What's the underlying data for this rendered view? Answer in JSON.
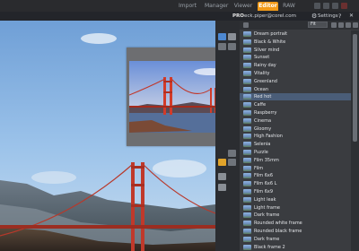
{
  "header": {
    "tabs": [
      {
        "label": "Import",
        "active": false
      },
      {
        "label": "Manager",
        "active": false
      },
      {
        "label": "Viewer",
        "active": false
      },
      {
        "label": "Editor",
        "active": true
      },
      {
        "label": "RAW",
        "active": false
      }
    ],
    "accent_color": "#f29a18"
  },
  "subheader": {
    "pro_label": "PRO",
    "email": "eck.piper@corel.com",
    "settings_label": "Settings",
    "help_label": "?",
    "icons": [
      "gear-icon",
      "close-icon"
    ]
  },
  "panel": {
    "fit_label": "Fit",
    "fit_value": "Fit",
    "presets": [
      {
        "label": "Dream portrait",
        "selected": false
      },
      {
        "label": "Black & White",
        "selected": false
      },
      {
        "label": "Silver mind",
        "selected": false
      },
      {
        "label": "Sunset",
        "selected": false
      },
      {
        "label": "Rainy day",
        "selected": false
      },
      {
        "label": "Vitality",
        "selected": false
      },
      {
        "label": "Greenland",
        "selected": false
      },
      {
        "label": "Ocean",
        "selected": false
      },
      {
        "label": "Red hot",
        "selected": true
      },
      {
        "label": "Caffe",
        "selected": false
      },
      {
        "label": "Raspberry",
        "selected": false
      },
      {
        "label": "Cinema",
        "selected": false
      },
      {
        "label": "Gloomy",
        "selected": false
      },
      {
        "label": "High Fashion",
        "selected": false
      },
      {
        "label": "Selenia",
        "selected": false
      },
      {
        "label": "Puzzle",
        "selected": false
      },
      {
        "label": "Film 35mm",
        "selected": false
      },
      {
        "label": "Film",
        "selected": false
      },
      {
        "label": "Film 6x6",
        "selected": false
      },
      {
        "label": "Film 6x6 L",
        "selected": false
      },
      {
        "label": "Film 6x9",
        "selected": false
      },
      {
        "label": "Light leak",
        "selected": false
      },
      {
        "label": "Light frame",
        "selected": false
      },
      {
        "label": "Dark frame",
        "selected": false
      },
      {
        "label": "Rounded white frame",
        "selected": false
      },
      {
        "label": "Rounded black frame",
        "selected": false
      },
      {
        "label": "Dark frame",
        "selected": false
      },
      {
        "label": "Black frame 2",
        "selected": false
      }
    ]
  },
  "photo": {
    "subject": "Golden Gate Bridge"
  }
}
